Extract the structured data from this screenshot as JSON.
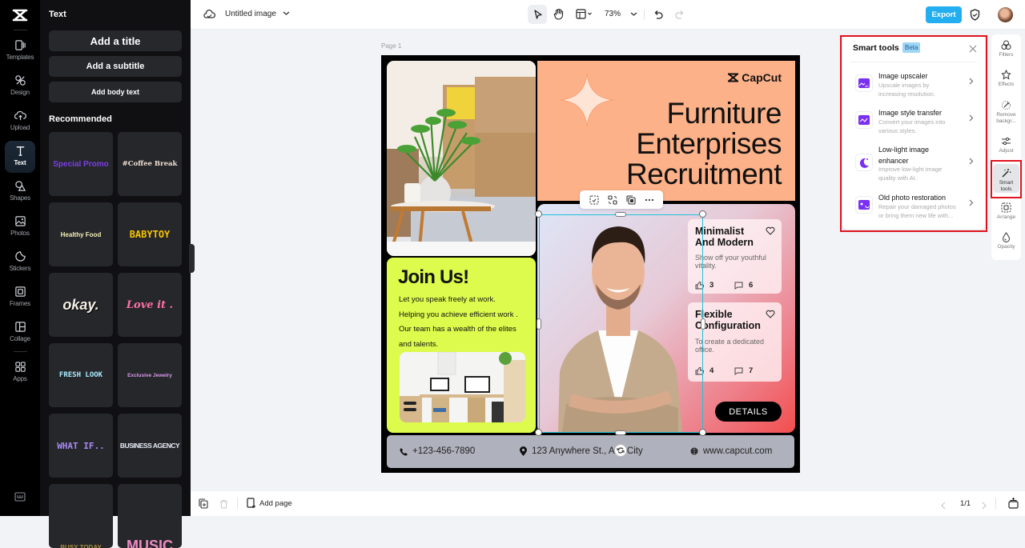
{
  "app": {
    "name": "CapCut",
    "document_title": "Untitled image"
  },
  "rail": {
    "items": [
      {
        "label": "Templates",
        "icon": "templates-icon"
      },
      {
        "label": "Design",
        "icon": "design-icon"
      },
      {
        "label": "Upload",
        "icon": "upload-cloud-icon"
      },
      {
        "label": "Text",
        "icon": "text-icon",
        "active": true
      },
      {
        "label": "Shapes",
        "icon": "shapes-icon"
      },
      {
        "label": "Photos",
        "icon": "photos-icon"
      },
      {
        "label": "Stickers",
        "icon": "stickers-icon"
      },
      {
        "label": "Frames",
        "icon": "frames-icon"
      },
      {
        "label": "Collage",
        "icon": "collage-icon"
      },
      {
        "label": "Apps",
        "icon": "apps-icon"
      }
    ]
  },
  "text_panel": {
    "title": "Text",
    "add_title": "Add a title",
    "add_subtitle": "Add a subtitle",
    "add_body": "Add body text",
    "recommended_label": "Recommended",
    "styles": [
      {
        "text": "Special Promo",
        "color": "#7b3fe4"
      },
      {
        "text": "#Coffee Break",
        "color": "#f3e3d6"
      },
      {
        "text": "Healthy Food",
        "color": "#f4f0b5"
      },
      {
        "text": "BABYTOY",
        "color": "#f5c400"
      },
      {
        "text": "okay.",
        "color": "#f5efe6"
      },
      {
        "text": "Love it .",
        "color": "#ff6fa8"
      },
      {
        "text": "FRESH LOOK",
        "color": "#a9ecff"
      },
      {
        "text": "Exclusive Jewelry",
        "color": "#d89be8"
      },
      {
        "text": "WHAT IF..",
        "color": "#a88af0"
      },
      {
        "text": "BUSINESS AGENCY",
        "color": "#e8ecf6"
      },
      {
        "text": "BUSY TODAY",
        "color": "#a8903a"
      },
      {
        "text": "MUSIC",
        "color": "#f08ac4"
      }
    ]
  },
  "toolbar": {
    "zoom_level": "73%",
    "export_label": "Export"
  },
  "canvas": {
    "page_label": "Page 1",
    "brand": "CapCut",
    "headline": [
      "Furniture",
      "Enterprises",
      "Recruitment"
    ],
    "join_title": "Join Us!",
    "join_lines": [
      "Let you speak freely at work.",
      "Helping you achieve efficient work .",
      "Our team has a wealth of the elites",
      "and talents."
    ],
    "features": [
      {
        "title_1": "Minimalist",
        "title_2": "And Modern",
        "desc_1": "Show off your youthful",
        "desc_2": "vitality.",
        "likes": "3",
        "comments": "6"
      },
      {
        "title_1": "Flexible",
        "title_2": "Configuration",
        "desc_1": "To create a dedicated",
        "desc_2": "office.",
        "likes": "4",
        "comments": "7"
      }
    ],
    "details_label": "DETAILS",
    "phone": "+123-456-7890",
    "address": "123 Anywhere St., Any City",
    "website": "www.capcut.com",
    "colors": {
      "peach": "#fdb188",
      "lime": "#dcfb4c",
      "red": "#f24e4e",
      "selection": "#1fc1d9"
    }
  },
  "smart_tools": {
    "title": "Smart tools",
    "badge": "Beta",
    "tools": [
      {
        "title": "Image upscaler",
        "desc_1": "Upscale images by",
        "desc_2": "increasing resolution.",
        "icon": "image-upscale-icon"
      },
      {
        "title": "Image style transfer",
        "desc_1": "Convert your images into",
        "desc_2": "various styles.",
        "icon": "style-transfer-icon"
      },
      {
        "title_1": "Low-light image",
        "title_2": "enhancer",
        "desc_1": "Improve low-light image",
        "desc_2": "quality with AI.",
        "icon": "moon-enhance-icon"
      },
      {
        "title": "Old photo restoration",
        "desc_1": "Repair your damaged photos",
        "desc_2": "or bring them new life with...",
        "icon": "photo-restore-icon"
      }
    ]
  },
  "right_sidebar": {
    "items": [
      {
        "label": "Filters"
      },
      {
        "label_1": "Remove",
        "label_2": "backgr..."
      },
      {
        "label": "Effects"
      },
      {
        "label": "Adjust"
      },
      {
        "label_1": "Smart",
        "label_2": "tools",
        "active": true
      },
      {
        "label": "Arrange"
      },
      {
        "label": "Opacity"
      }
    ]
  },
  "bottombar": {
    "add_page": "Add page",
    "page_indicator": "1/1"
  }
}
